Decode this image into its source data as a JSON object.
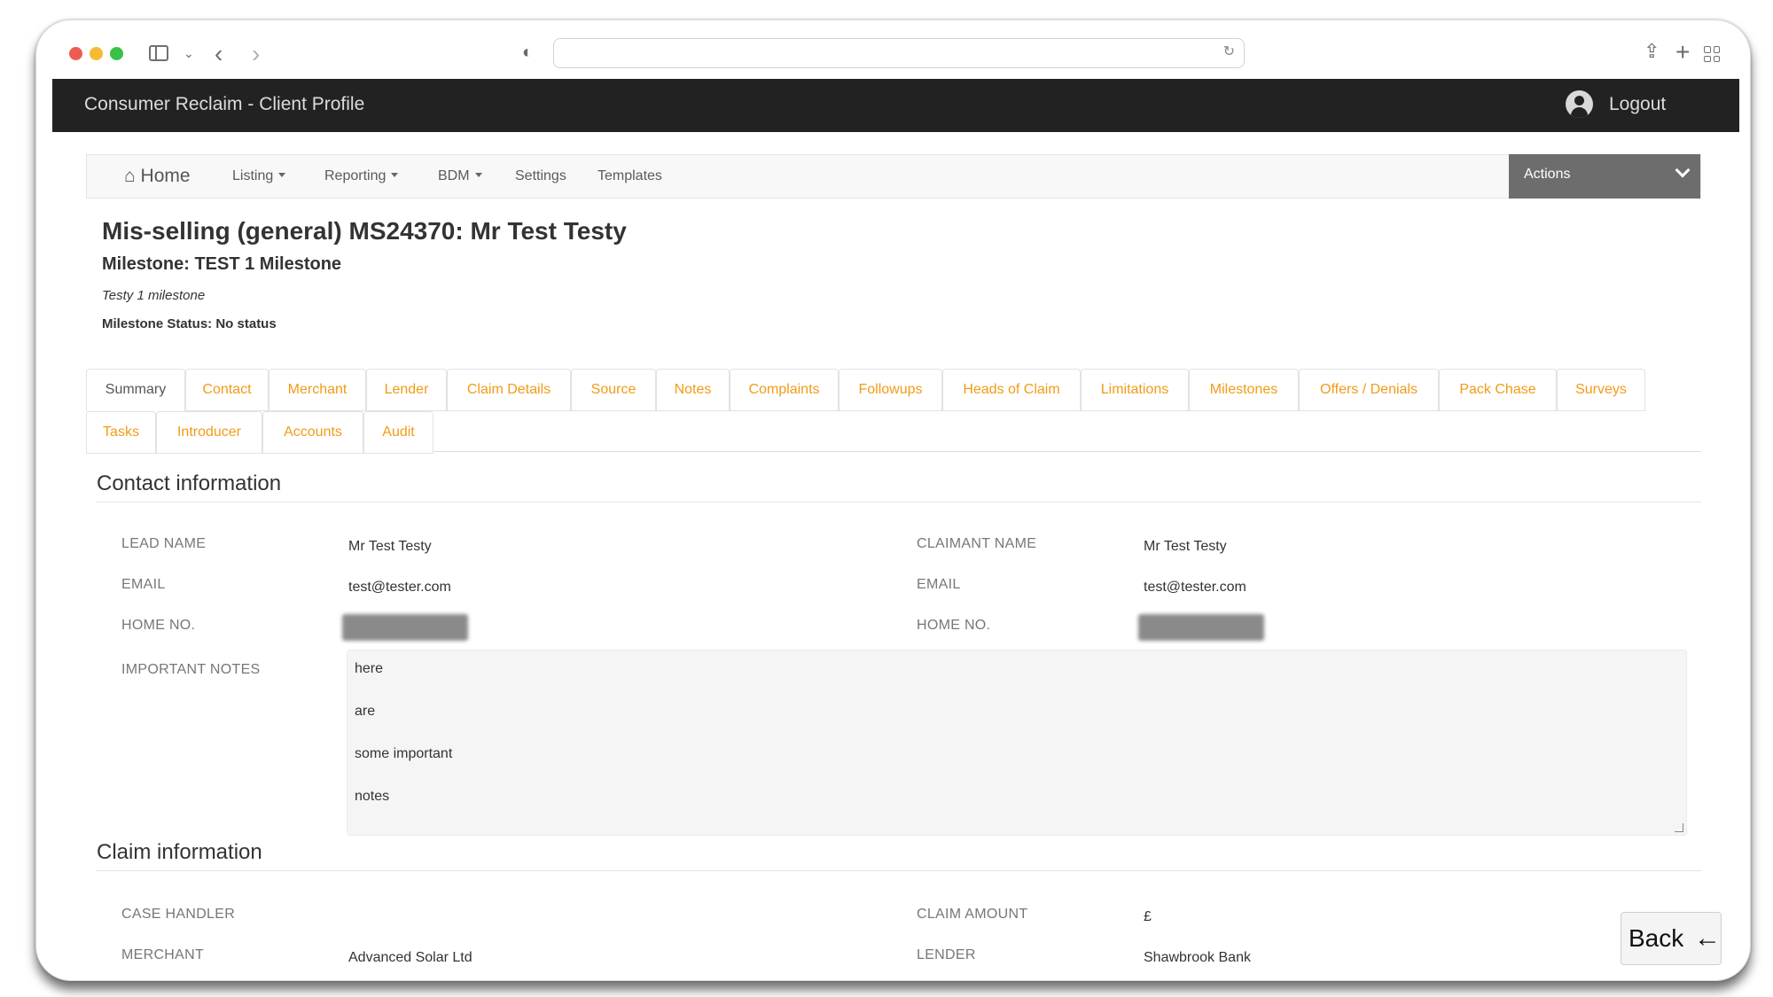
{
  "browser": {
    "icons": {
      "sidebar": "sidebar-icon",
      "back": "chevron-left-icon",
      "forward": "chevron-right-icon",
      "shield": "shield-icon",
      "reload": "reload-icon",
      "share": "share-icon",
      "new_tab": "plus-icon",
      "tabs": "tab-overview-icon"
    }
  },
  "app": {
    "title": "Consumer Reclaim - Client Profile",
    "logout": "Logout"
  },
  "nav": {
    "home": "Home",
    "listing": "Listing",
    "reporting": "Reporting",
    "bdm": "BDM",
    "settings": "Settings",
    "templates": "Templates",
    "actions": "Actions"
  },
  "header": {
    "title": "Mis-selling (general) MS24370: Mr Test Testy",
    "milestone": "Milestone: TEST 1 Milestone",
    "milestone_desc": "Testy 1 milestone",
    "milestone_status": "Milestone Status: No status"
  },
  "tabs": [
    "Summary",
    "Contact",
    "Merchant",
    "Lender",
    "Claim Details",
    "Source",
    "Notes",
    "Complaints",
    "Followups",
    "Heads of Claim",
    "Limitations",
    "Milestones",
    "Offers / Denials",
    "Pack Chase",
    "Surveys",
    "Tasks",
    "Introducer",
    "Accounts",
    "Audit"
  ],
  "contact": {
    "title": "Contact information",
    "lead_name_label": "LEAD NAME",
    "lead_name": "Mr Test Testy",
    "claimant_name_label": "CLAIMANT NAME",
    "claimant_name": "Mr Test Testy",
    "email_label": "EMAIL",
    "email": "test@tester.com",
    "email2_label": "EMAIL",
    "email2": "test@tester.com",
    "home_label": "HOME NO.",
    "home2_label": "HOME NO.",
    "notes_label": "IMPORTANT NOTES",
    "notes": [
      "here",
      "are",
      "some important",
      "notes"
    ]
  },
  "claim": {
    "title": "Claim information",
    "case_handler_label": "CASE HANDLER",
    "claim_amount_label": "CLAIM AMOUNT",
    "claim_amount": "£",
    "merchant_label": "MERCHANT",
    "merchant": "Advanced Solar Ltd",
    "lender_label": "LENDER",
    "lender": "Shawbrook Bank"
  },
  "back_button": "Back"
}
